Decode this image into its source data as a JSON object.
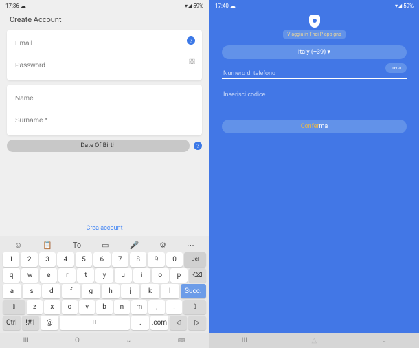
{
  "left": {
    "status": {
      "time": "17:36",
      "battery": "59%"
    },
    "title": "Create Account",
    "fields": {
      "email_placeholder": "Email",
      "password_placeholder": "Password",
      "name_placeholder": "Name",
      "surname_placeholder": "Surname *"
    },
    "dob_label": "Date Of Birth",
    "create_link": "Crea account",
    "keyboard": {
      "toolbar_to": "To",
      "row1": [
        "1",
        "2",
        "3",
        "4",
        "5",
        "6",
        "7",
        "8",
        "9",
        "0"
      ],
      "del": "Del",
      "row2": [
        "q",
        "w",
        "e",
        "r",
        "t",
        "y",
        "u",
        "i",
        "o",
        "p"
      ],
      "row3": [
        "a",
        "s",
        "d",
        "f",
        "g",
        "h",
        "j",
        "k",
        "l"
      ],
      "succ": "Succ.",
      "row4": [
        "z",
        "x",
        "c",
        "v",
        "b",
        "n",
        "m"
      ],
      "ctrl": "Ctrl",
      "sym": "!#1",
      "at": "@",
      "lang": "IT",
      "dot": ".",
      "com": ".com"
    }
  },
  "right": {
    "status": {
      "time": "17:40",
      "battery": "59%"
    },
    "chip": "Viaggia in Thai P app gna",
    "country": "Italy (+39)",
    "phone_placeholder": "Numero di telefono",
    "send": "Invia",
    "code_placeholder": "Inserisci codice",
    "confirm_a": "Confer",
    "confirm_b": "ma"
  },
  "nav": {
    "recents": "III",
    "home": "O",
    "back": "⌄"
  }
}
